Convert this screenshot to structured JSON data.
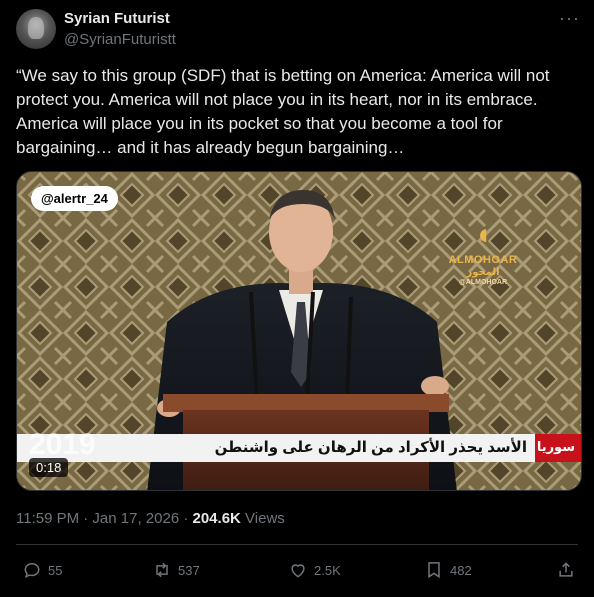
{
  "author": {
    "display_name": "Syrian Futurist",
    "handle": "@SyrianFuturistt"
  },
  "tweet": {
    "text": "“We say to this group (SDF) that is betting on America:  America will not protect you. America will not place you in its heart, nor in its embrace. America will place you in its pocket so that you become a tool for bargaining… and it has already begun bargaining…"
  },
  "media": {
    "watermark_handle": "@alertr_24",
    "brand_name": "ALMOHOAR",
    "brand_sub": "المحور",
    "brand_handle": "@ALMOHOAR",
    "ticker_label": "سوريا",
    "ticker_text": "الأسد يحذر الأكراد من الرهان على واشنطن",
    "year_overlay": "2019",
    "duration": "0:18"
  },
  "meta": {
    "timestamp": "11:59 PM · Jan 17, 2026 ·",
    "views_count": "204.6K",
    "views_label": "Views"
  },
  "actions": {
    "replies": "55",
    "reposts": "537",
    "likes": "2.5K",
    "bookmarks": "482"
  },
  "icons": {
    "more": "more-icon",
    "reply": "reply-icon",
    "repost": "repost-icon",
    "like": "heart-icon",
    "bookmark": "bookmark-icon",
    "share": "share-icon"
  },
  "colors": {
    "background": "#000000",
    "text": "#e7e9ea",
    "secondary": "#71767b",
    "ticker_red": "#c7121c",
    "brand_gold": "#e9b64a"
  }
}
